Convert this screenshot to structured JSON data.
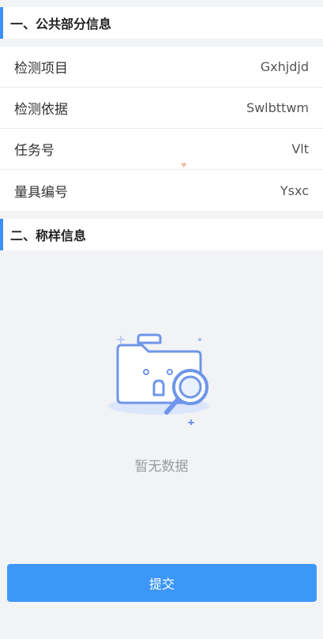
{
  "section1": {
    "title": "一、公共部分信息"
  },
  "rows": [
    {
      "label": "检测项目",
      "value": "Gxhjdjd"
    },
    {
      "label": "检测依据",
      "value": "Swlbttwm"
    },
    {
      "label": "任务号",
      "value": "Vlt"
    },
    {
      "label": "量具编号",
      "value": "Ysxc"
    }
  ],
  "section2": {
    "title": "二、称样信息"
  },
  "empty_state": {
    "icon": "empty-folder-search-icon",
    "text": "暂无数据"
  },
  "submit_label": "提交",
  "colors": {
    "accent": "#3d8ff7",
    "button": "#3d97f8"
  }
}
